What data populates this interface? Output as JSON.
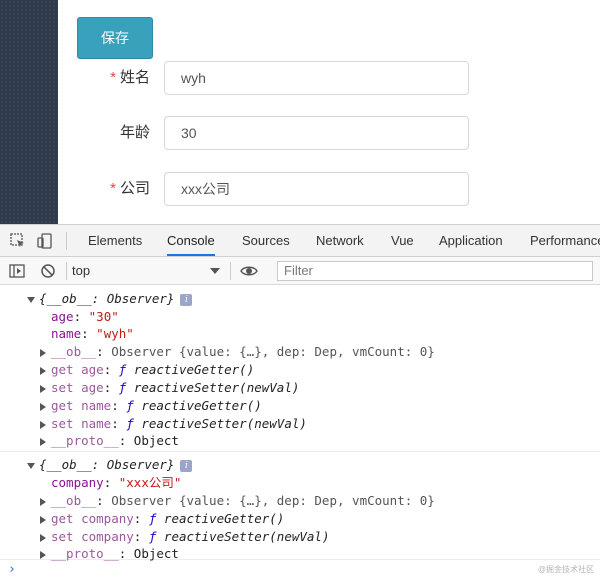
{
  "form": {
    "save_label": "保存",
    "name_label": "姓名",
    "name_value": "wyh",
    "age_label": "年龄",
    "age_value": "30",
    "company_label": "公司",
    "company_value": "xxx公司",
    "required_mark": "*"
  },
  "devtools": {
    "tabs": [
      "Elements",
      "Console",
      "Sources",
      "Network",
      "Vue",
      "Application",
      "Performance"
    ],
    "active_tab": "Console",
    "context": "top",
    "filter_placeholder": "Filter"
  },
  "console": {
    "log1": {
      "header": "{__ob__: Observer}",
      "age_key": "age",
      "age_val": "\"30\"",
      "name_key": "name",
      "name_val": "\"wyh\"",
      "ob_key": "__ob__",
      "ob_val": "Observer {value: {…}, dep: Dep, vmCount: 0}",
      "get_age": "get age",
      "set_age": "set age",
      "get_name": "get name",
      "set_name": "set name",
      "getter": "reactiveGetter()",
      "setter": "reactiveSetter(newVal)",
      "f": "ƒ",
      "proto_key": "__proto__",
      "proto_val": "Object"
    },
    "log2": {
      "header": "{__ob__: Observer}",
      "company_key": "company",
      "company_val": "\"xxx公司\"",
      "ob_key": "__ob__",
      "ob_val": "Observer {value: {…}, dep: Dep, vmCount: 0}",
      "get_company": "get company",
      "set_company": "set company",
      "getter": "reactiveGetter()",
      "setter": "reactiveSetter(newVal)",
      "f": "ƒ",
      "proto_key": "__proto__",
      "proto_val": "Object"
    },
    "info_badge": "i",
    "prompt": "›",
    "watermark": "@掘金技术社区"
  }
}
